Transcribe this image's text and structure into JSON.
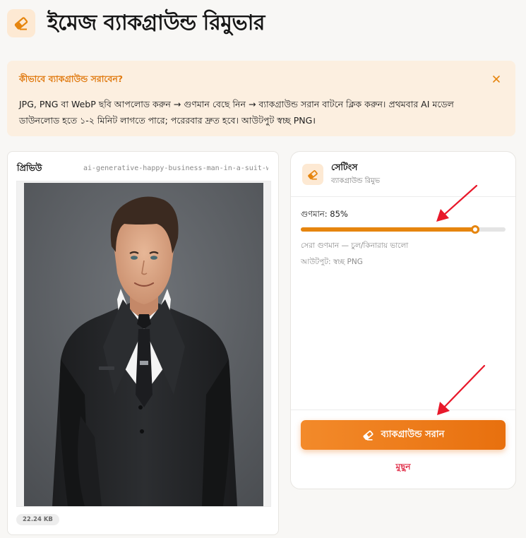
{
  "header": {
    "title": "ইমেজ ব্যাকগ্রাউন্ড রিমুভার",
    "logo_icon": "eraser-icon"
  },
  "info": {
    "title": "কীভাবে ব্যাকগ্রাউন্ড সরাবেন?",
    "text": "JPG, PNG বা WebP ছবি আপলোড করুন → গুণমান বেছে নিন → ব্যাকগ্রাউন্ড সরান বাটনে ক্লিক করুন। প্রথমবার AI মডেল ডাউনলোড হতে ১-২ মিনিট লাগতে পারে; পরেরবার দ্রুত হবে। আউটপুট স্বচ্ছ PNG।",
    "close_icon": "close-icon"
  },
  "preview": {
    "label": "প্রিভিউ",
    "filename": "ai-generative-happy-business-man-in-a-suit-whi...",
    "size": "22.24 KB"
  },
  "settings": {
    "title": "সেটিংস",
    "subtitle": "ব্যাকগ্রাউন্ড রিমুভ",
    "quality_label": "গুণমান: 85%",
    "quality_value": 85,
    "hint_quality": "সেরা গুণমান — চুল/কিনারায় ভালো",
    "hint_output": "আউটপুট: স্বচ্ছ PNG",
    "remove_button": "ব্যাকগ্রাউন্ড সরান",
    "clear_link": "মুছুন"
  },
  "colors": {
    "accent": "#e6850e",
    "info_bg": "#fcefe0",
    "danger": "#e0304a",
    "arrow": "#e8182a"
  }
}
